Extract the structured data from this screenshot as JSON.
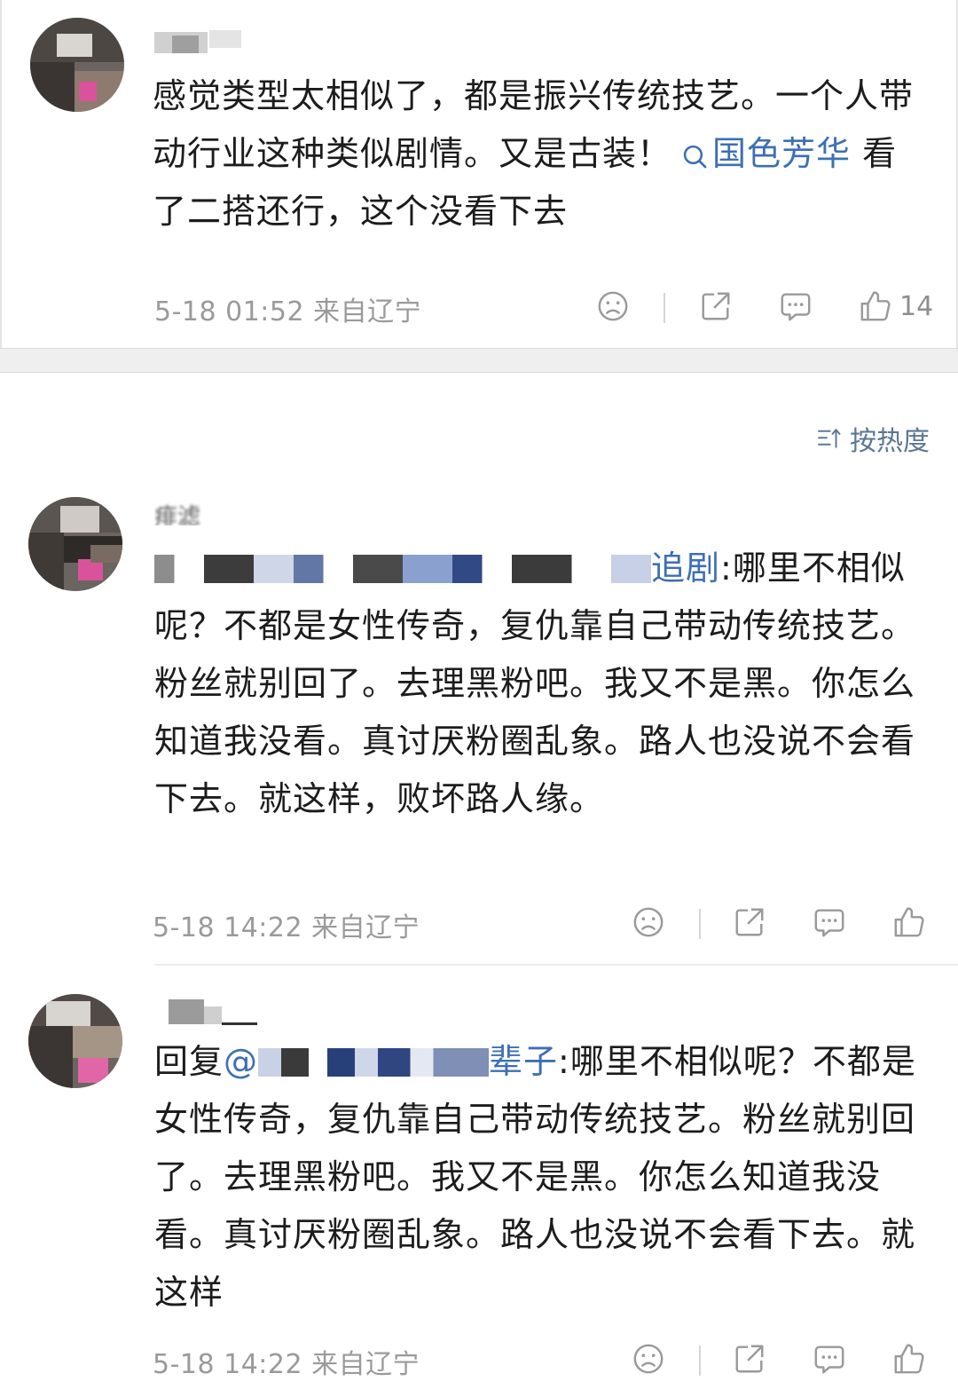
{
  "post": {
    "text_before_link": "感觉类型太相似了，都是振兴传统技艺。一个人带动行业这种类似剧情。又是古装！",
    "link": "国色芳华",
    "text_after_link": " 看了二搭还行，这个没看下去",
    "meta": "5-18 01:52  来自辽宁",
    "like_count": "14"
  },
  "sort_label": "按热度",
  "comments": [
    {
      "username": "痱滤",
      "mention_tail": "追剧",
      "text": ":哪里不相似呢？不都是女性传奇，复仇靠自己带动传统技艺。粉丝就别回了。去理黑粉吧。我又不是黑。你怎么知道我没看。真讨厌粉圈乱象。路人也没说不会看下去。就这样，败坏路人缘。",
      "meta": "5-18 14:22  来自辽宁"
    },
    {
      "username": "",
      "reply_prefix": "回复",
      "mention_head": "@",
      "mention_tail": "辈子",
      "text": ":哪里不相似呢？不都是女性传奇，复仇靠自己带动传统技艺。粉丝就别回了。去理黑粉吧。我又不是黑。你怎么知道我没看。真讨厌粉圈乱象。路人也没说不会看下去。就这样",
      "meta": "5-18 14:22  来自辽宁"
    }
  ],
  "icons": {
    "dislike": "frown-face-icon",
    "share": "share-icon",
    "comment": "comment-bubble-icon",
    "like": "thumbs-up-icon",
    "search": "search-icon",
    "sort": "sort-icon"
  },
  "colors": {
    "link": "#3d6fb4",
    "meta": "#9a9a9a",
    "separator": "#efefef"
  }
}
